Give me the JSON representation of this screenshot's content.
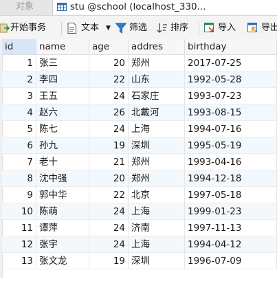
{
  "tabs": {
    "objects_label": "对象",
    "active_title": "stu @school (localhost_330..."
  },
  "toolbar": {
    "begin_transaction": "开始事务",
    "text": "文本",
    "filter": "筛选",
    "sort": "排序",
    "import": "导入",
    "export": "导出"
  },
  "table": {
    "columns": [
      "id",
      "name",
      "age",
      "addres",
      "birthday"
    ],
    "rows": [
      [
        "1",
        "张三",
        "20",
        "郑州",
        "2017-07-25"
      ],
      [
        "2",
        "李四",
        "22",
        "山东",
        "1992-05-28"
      ],
      [
        "3",
        "王五",
        "24",
        "石家庄",
        "1993-07-23"
      ],
      [
        "4",
        "赵六",
        "26",
        "北戴河",
        "1993-08-15"
      ],
      [
        "5",
        "陈七",
        "24",
        "上海",
        "1994-07-16"
      ],
      [
        "6",
        "孙九",
        "19",
        "深圳",
        "1995-05-19"
      ],
      [
        "7",
        "老十",
        "21",
        "郑州",
        "1993-04-16"
      ],
      [
        "8",
        "沈中强",
        "20",
        "郑州",
        "1994-12-18"
      ],
      [
        "9",
        "郭中华",
        "22",
        "北京",
        "1997-05-18"
      ],
      [
        "10",
        "陈萌",
        "24",
        "上海",
        "1999-01-23"
      ],
      [
        "11",
        "谭萍",
        "24",
        "济南",
        "1997-11-13"
      ],
      [
        "12",
        "张宇",
        "24",
        "上海",
        "1994-04-12"
      ],
      [
        "13",
        "张文龙",
        "19",
        "深圳",
        "1996-07-09"
      ]
    ]
  },
  "colors": {
    "accent": "#2f6fb3",
    "header_active": "#d7e7f7",
    "row_alt": "#f3f8fd",
    "import_icon": "#2e8b57",
    "filter_icon": "#2f7fd0"
  }
}
